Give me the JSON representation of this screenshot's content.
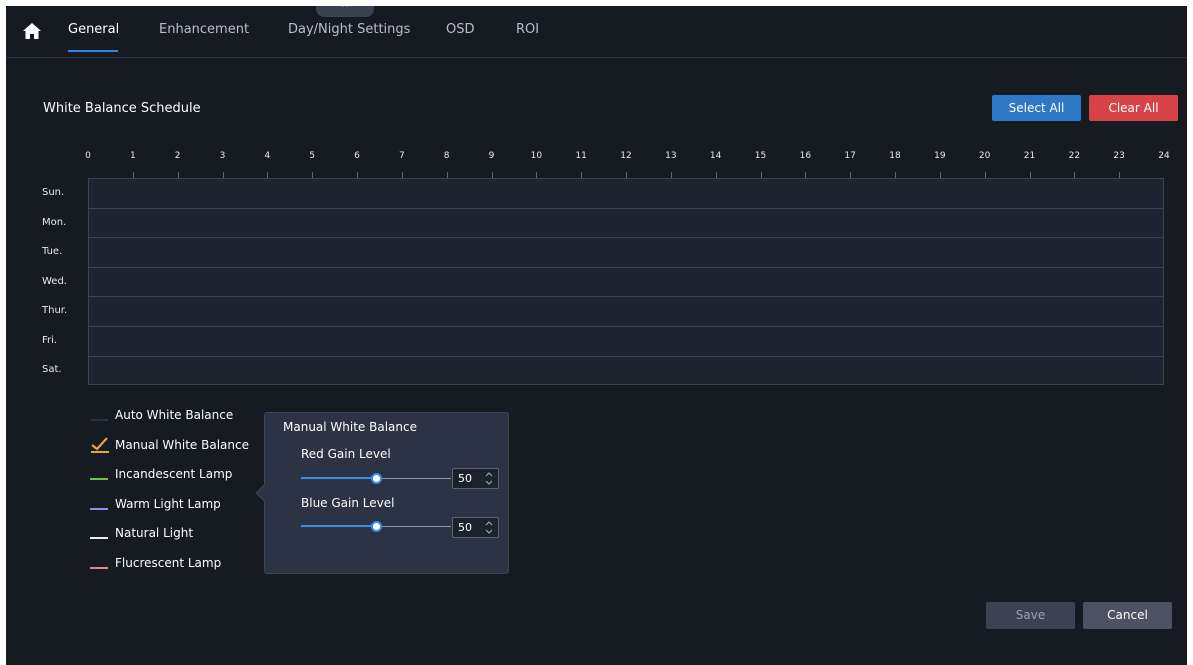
{
  "tabs": [
    {
      "label": "General",
      "active": true
    },
    {
      "label": "Enhancement",
      "active": false
    },
    {
      "label": "Day/Night Settings",
      "active": false
    },
    {
      "label": "OSD",
      "active": false
    },
    {
      "label": "ROI",
      "active": false
    }
  ],
  "collapse_glyph": "^",
  "schedule": {
    "title": "White Balance Schedule",
    "select_all_label": "Select All",
    "clear_all_label": "Clear All",
    "hours": [
      "0",
      "1",
      "2",
      "3",
      "4",
      "5",
      "6",
      "7",
      "8",
      "9",
      "10",
      "11",
      "12",
      "13",
      "14",
      "15",
      "16",
      "17",
      "18",
      "19",
      "20",
      "21",
      "22",
      "23",
      "24"
    ],
    "days": [
      "Sun.",
      "Mon.",
      "Tue.",
      "Wed.",
      "Thur.",
      "Fri.",
      "Sat."
    ]
  },
  "legend": [
    {
      "label": "Auto White Balance",
      "color": "#2a3140",
      "selected": false
    },
    {
      "label": "Manual White Balance",
      "color": "#e8a33c",
      "selected": true
    },
    {
      "label": "Incandescent Lamp",
      "color": "#6fbf4a",
      "selected": false
    },
    {
      "label": "Warm Light Lamp",
      "color": "#8b8ff0",
      "selected": false
    },
    {
      "label": "Natural Light",
      "color": "#e6eef7",
      "selected": false
    },
    {
      "label": "Flucrescent Lamp",
      "color": "#e5868e",
      "selected": false
    }
  ],
  "manual_popup": {
    "title": "Manual White Balance",
    "red_gain": {
      "label": "Red Gain Level",
      "value": "50",
      "max": 100
    },
    "blue_gain": {
      "label": "Blue Gain Level",
      "value": "50",
      "max": 100
    }
  },
  "footer": {
    "save_label": "Save",
    "cancel_label": "Cancel"
  },
  "colors": {
    "accent": "#2f86e2",
    "select_all": "#2f78c6",
    "clear_all": "#d84347",
    "background": "#161a21"
  },
  "icons": {
    "home": "home-icon",
    "collapse": "chevron-up-icon",
    "check": "check-icon",
    "spinner": "spinner-arrows-icon"
  }
}
